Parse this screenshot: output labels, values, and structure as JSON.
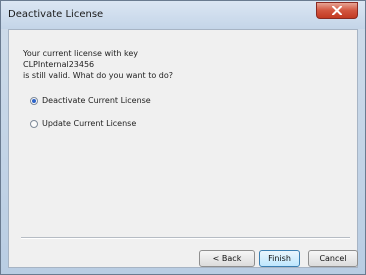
{
  "window": {
    "title": "Deactivate License"
  },
  "message": {
    "line1": "Your current license with key",
    "line2": "CLPInternal23456",
    "line3": "is still valid. What do you want to do?"
  },
  "options": [
    {
      "label": "Deactivate Current License",
      "selected": true
    },
    {
      "label": "Update Current License",
      "selected": false
    }
  ],
  "buttons": {
    "back": "< Back",
    "finish": "Finish",
    "cancel": "Cancel"
  }
}
